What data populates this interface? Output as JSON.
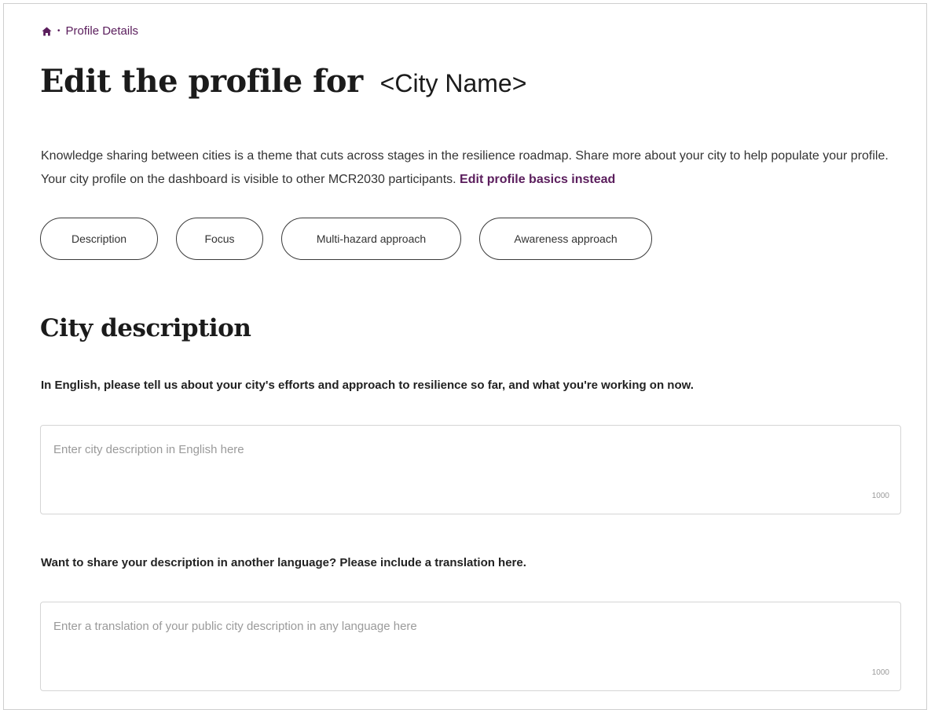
{
  "breadcrumb": {
    "home_icon": "home-icon",
    "separator": "•",
    "current": "Profile Details"
  },
  "header": {
    "title": "Edit the profile for",
    "city_placeholder": "<City Name>"
  },
  "intro": {
    "text": "Knowledge sharing between cities is a theme that cuts across stages in the resilience roadmap. Share more about your city to help populate your profile. Your city profile on the dashboard is visible to other MCR2030 participants.",
    "link": "Edit profile basics instead"
  },
  "chips": [
    "Description",
    "Focus",
    "Multi-hazard approach",
    "Awareness approach"
  ],
  "section": {
    "title": "City description"
  },
  "fields": [
    {
      "label": "In English, please tell us about your city's efforts and approach to resilience so far, and what you're working on now.",
      "placeholder": "Enter city description in English here",
      "value": "",
      "counter": "1000"
    },
    {
      "label": "Want to share your description in another language? Please include a translation here.",
      "placeholder": "Enter a translation of your public city description in any language here",
      "value": "",
      "counter": "1000"
    }
  ],
  "colors": {
    "accent": "#5a1d5c",
    "border": "#d5d5d5",
    "placeholder": "#9a9a9a"
  }
}
